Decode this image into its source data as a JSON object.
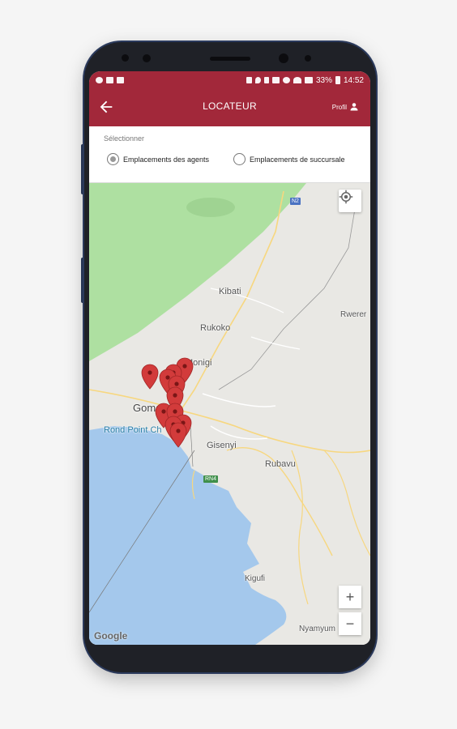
{
  "statusbar": {
    "battery": "33%",
    "time": "14:52"
  },
  "appbar": {
    "title": "LOCATEUR",
    "profile_label": "Profil"
  },
  "selector": {
    "label": "Sélectionner",
    "options": [
      {
        "label": "Emplacements des agents",
        "selected": true
      },
      {
        "label": "Emplacements de succursale",
        "selected": false
      }
    ]
  },
  "map": {
    "labels": {
      "kibati": "Kibati",
      "rukoko": "Rukoko",
      "monigi": "Monigi",
      "goma": "Goma",
      "rond_point": "Rond Point Ch",
      "gisenyi": "Gisenyi",
      "rubavu": "Rubavu",
      "rwerere": "Rwerer",
      "kigufi": "Kigufi",
      "nyamyumba": "Nyamyum"
    },
    "road_shields": {
      "n2": "N2",
      "rn4": "RN4"
    },
    "zoom_in": "+",
    "zoom_out": "−",
    "attribution": "Google"
  },
  "colors": {
    "brand": "#a2283a",
    "marker": "#d23b3b"
  }
}
